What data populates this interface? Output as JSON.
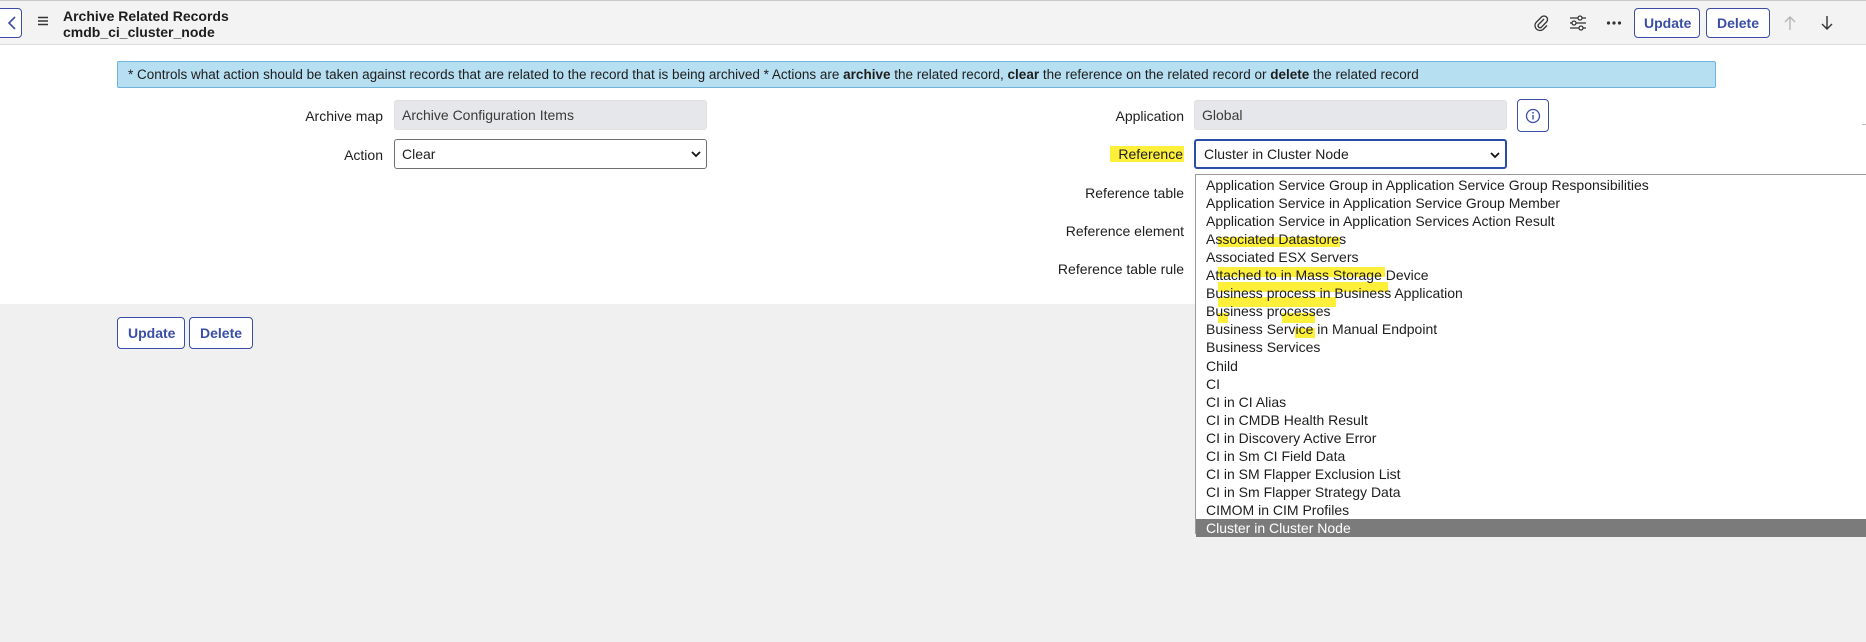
{
  "header": {
    "title": "Archive Related Records",
    "subtitle": "cmdb_ci_cluster_node",
    "update_label": "Update",
    "delete_label": "Delete"
  },
  "banner": {
    "part1": "* Controls what action should be taken against records that are related to the record that is being archived * Actions are ",
    "kw1": "archive",
    "part2": " the related record, ",
    "kw2": "clear",
    "part3": " the reference on the related record or ",
    "kw3": "delete",
    "part4": " the related record"
  },
  "form": {
    "archive_map_label": "Archive map",
    "archive_map_value": "Archive Configuration Items",
    "action_label": "Action",
    "action_value": "Clear",
    "application_label": "Application",
    "application_value": "Global",
    "reference_label": "Reference",
    "reference_value": "Cluster in Cluster Node",
    "reference_table_label": "Reference table",
    "reference_element_label": "Reference element",
    "reference_table_rule_label": "Reference table rule"
  },
  "footer": {
    "update_label": "Update",
    "delete_label": "Delete"
  },
  "dropdown": {
    "options": [
      "Application Service Group in Application Service Group Responsibilities",
      "Application Service in Application Service Group Member",
      "Application Service in Application Services Action Result",
      "Associated Datastores",
      "Associated ESX Servers",
      "Attached to in Mass Storage Device",
      "Business process in Business Application",
      "Business processes",
      "Business Service in Manual Endpoint",
      "Business Services",
      "Child",
      "CI",
      "CI in CI Alias",
      "CI in CMDB Health Result",
      "CI in Discovery Active Error",
      "CI in Sm CI Field Data",
      "CI in SM Flapper Exclusion List",
      "CI in Sm Flapper Strategy Data",
      "CIMOM in CIM Profiles",
      "Cluster in Cluster Node"
    ],
    "selected_index": 19
  },
  "colors": {
    "accent": "#3a4ea8",
    "banner_bg": "#b7dff2",
    "highlight": "#fdef3a",
    "selected_option_bg": "#7b7b7b"
  },
  "icons": [
    "chevron-left-icon",
    "hamburger-menu-icon",
    "paperclip-icon",
    "sliders-icon",
    "more-icon",
    "arrow-up-icon",
    "arrow-down-icon",
    "info-icon",
    "chevron-down-icon"
  ]
}
